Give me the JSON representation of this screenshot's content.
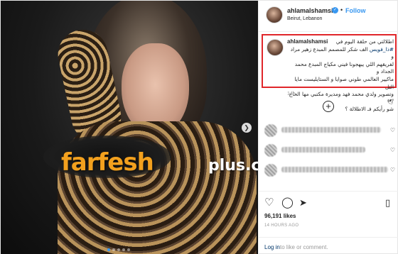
{
  "post": {
    "username": "ahlamalshamsi",
    "follow_label": "Follow",
    "separator": "•",
    "location": "Beirut, Lebanon",
    "verified_icon": "verified-icon"
  },
  "caption": {
    "username": "ahlamalshamsi",
    "line1": "اطلالتي من حلقة اليوم في",
    "hashtag": "#ذا_فويس",
    "line2": "الف شكر للمصمم المبدع زهير مراد و",
    "line3": "لفريقهم اللي يبهجونا فيني مكياج المبدع محمد الجداد و",
    "line4": "ماكيير العالمي طوني صوايا و الستايليست مايا التل",
    "line5": "وتصوير ولدي محمد فهد ومديرة مكتبي مها الحاج 🕊",
    "line6": "شو رأيكم فـ الاطلالة ؟",
    "time": "14h"
  },
  "watermark": {
    "brand": "farfesh",
    "suffix": "plus.com"
  },
  "actions": {
    "likes": "96,191 likes",
    "time_ago": "14 HOURS AGO",
    "login_link": "Log in",
    "login_rest": "to like or comment."
  },
  "colors": {
    "accent": "#3897f0",
    "highlight_border": "#e0262a",
    "link": "#003569"
  }
}
